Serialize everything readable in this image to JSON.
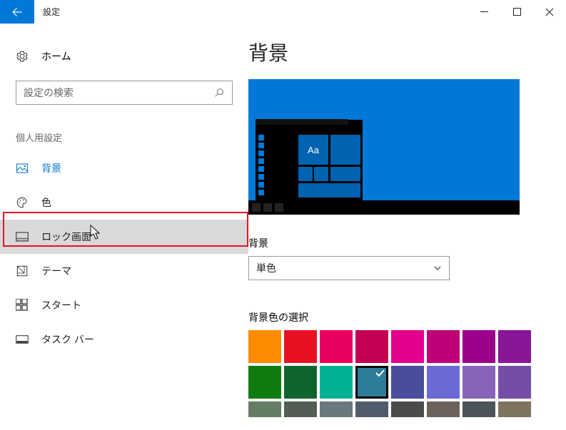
{
  "titlebar": {
    "app_title": "設定"
  },
  "sidebar": {
    "home": "ホーム",
    "search_placeholder": "設定の検索",
    "category": "個人用設定",
    "items": [
      {
        "label": "背景"
      },
      {
        "label": "色"
      },
      {
        "label": "ロック画面"
      },
      {
        "label": "テーマ"
      },
      {
        "label": "スタート"
      },
      {
        "label": "タスク バー"
      }
    ]
  },
  "main": {
    "title": "背景",
    "preview_sample": "Aa",
    "bg_label": "背景",
    "bg_dropdown_value": "単色",
    "color_label": "背景色の選択",
    "swatches_row1": [
      "#ff8c00",
      "#e81123",
      "#ea005e",
      "#c30052",
      "#e3008c",
      "#bf0077",
      "#9a0089",
      "#881798"
    ],
    "swatches_row2": [
      "#107c10",
      "#0d652d",
      "#00b294",
      "#2d7d9a",
      "#4a4d9e",
      "#6b69d6",
      "#8764b8",
      "#744da9"
    ],
    "swatches_row3": [
      "#647c64",
      "#525e54",
      "#69797e",
      "#515c6b",
      "#4c4a48",
      "#6a625b",
      "#4a5459",
      "#7e735f"
    ],
    "selected_index_row2": 3
  }
}
